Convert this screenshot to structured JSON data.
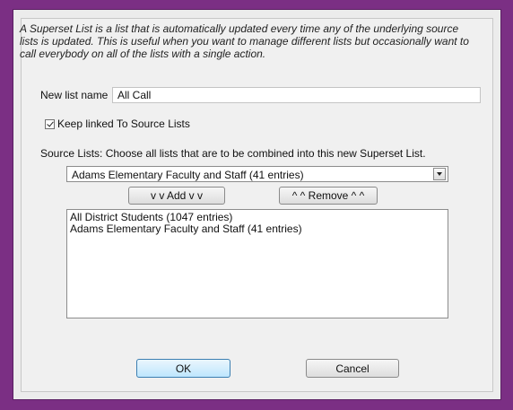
{
  "description": "A Superset List is a list that is automatically updated every time any of the underlying source lists is updated. This is useful when you want to manage different lists but occasionally want to call everybody on all of the lists with a single action.",
  "new_list": {
    "label": "New list name",
    "value": "All Call"
  },
  "keep_linked": {
    "label": "Keep linked To Source Lists",
    "checked": true
  },
  "source_lists_label": "Source Lists: Choose all lists that are to be combined into this new Superset List.",
  "source_select": {
    "selected": "Adams Elementary Faculty and Staff (41 entries)"
  },
  "buttons": {
    "add": "v v  Add  v v",
    "remove": "^ ^  Remove  ^ ^",
    "ok": "OK",
    "cancel": "Cancel"
  },
  "selected_lists": [
    "All District Students (1047 entries)",
    "Adams Elementary Faculty and Staff (41 entries)"
  ],
  "colors": {
    "border": "#7b2f84",
    "dialog": "#f0f0f0"
  }
}
